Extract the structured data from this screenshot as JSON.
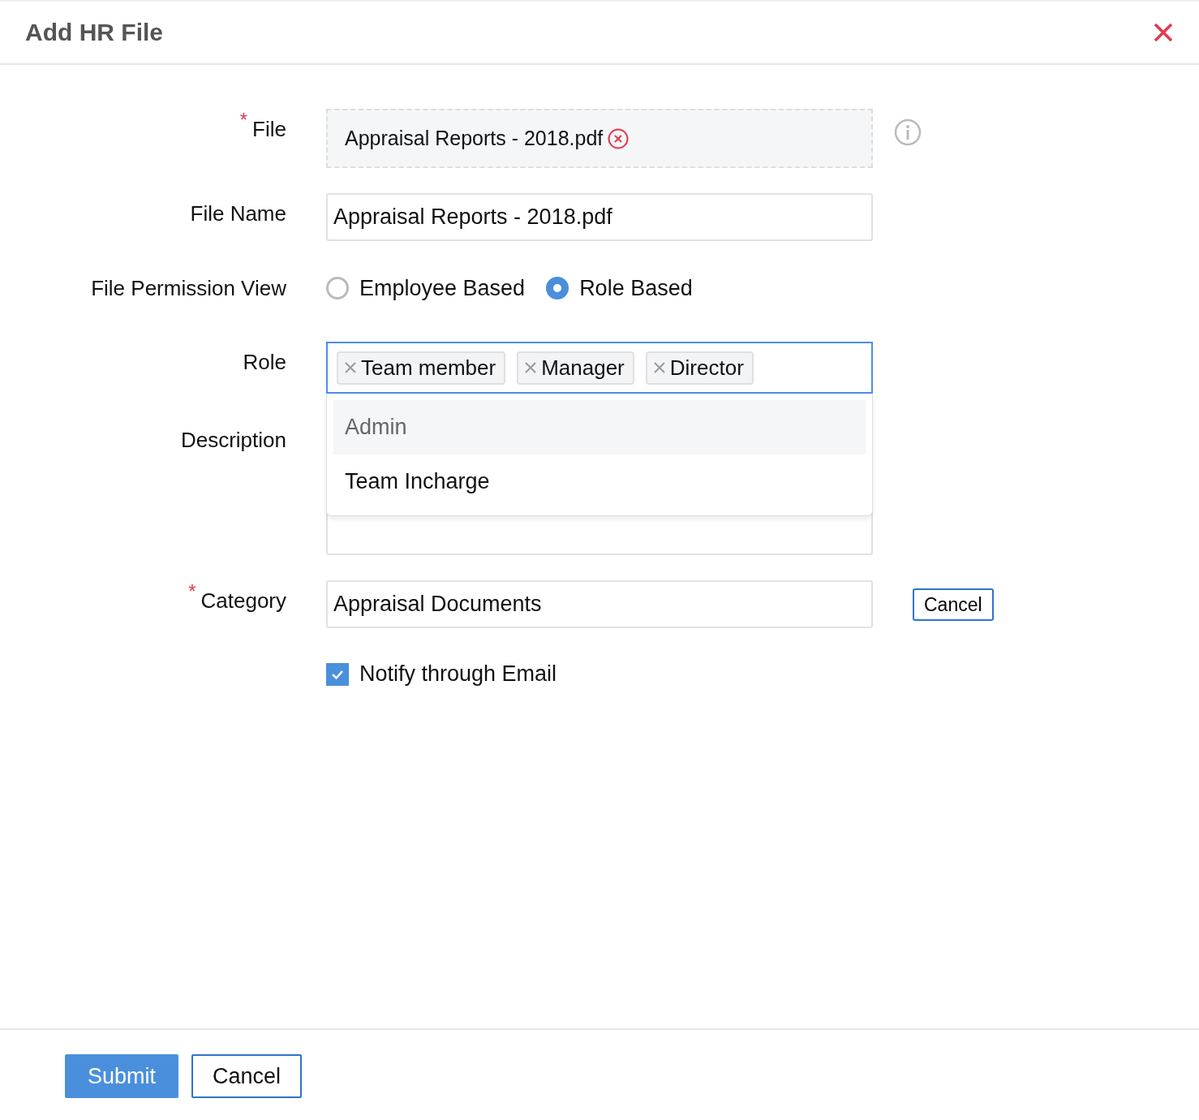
{
  "title": "Add HR File",
  "form": [
    {
      "kind": "file",
      "label": "File",
      "required_mark": "*",
      "file_name": "Appraisal Reports - 2018.pdf"
    },
    {
      "kind": "text",
      "label": "File Name",
      "value": "Appraisal Reports - 2018.pdf"
    },
    {
      "kind": "radio",
      "label": "File Permission View",
      "options": [
        {
          "label": "Employee Based",
          "selected": false
        },
        {
          "label": "Role Based",
          "selected": true
        }
      ]
    },
    {
      "kind": "tags",
      "label": "Role",
      "tags": [
        "Team member",
        "Manager",
        "Director"
      ],
      "dropdown": [
        {
          "label": "Admin",
          "selected": true
        },
        {
          "label": "Team Incharge",
          "selected": false
        }
      ]
    },
    {
      "kind": "textarea",
      "label": "Description"
    },
    {
      "kind": "text",
      "label": "Category",
      "required_mark": "*",
      "value": "Appraisal Documents",
      "button": "Cancel"
    },
    {
      "kind": "checkbox",
      "label": "Notify through Email",
      "checked": true
    }
  ],
  "footer_buttons": [
    {
      "label": "Submit",
      "kind": "primary"
    },
    {
      "label": "Cancel",
      "kind": "secondary"
    }
  ]
}
